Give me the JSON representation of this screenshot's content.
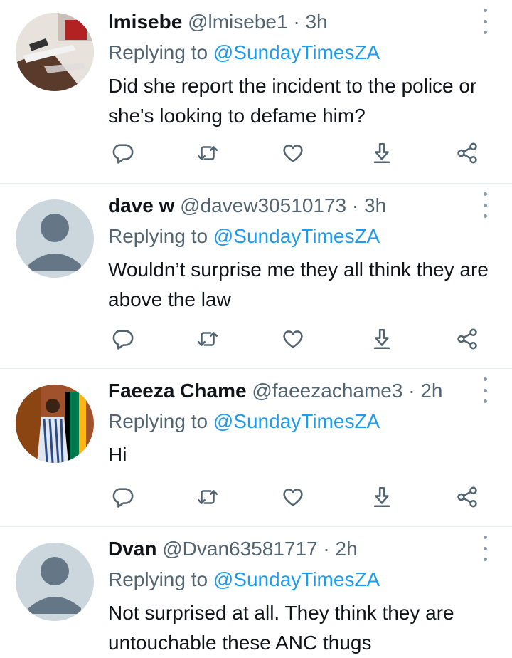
{
  "colors": {
    "mention": "#1d9bf0",
    "secondary_text": "#536471",
    "icon": "#536471",
    "divider": "#e6ecf0"
  },
  "tweets": [
    {
      "name": "lmisebe",
      "handle": "@lmisebe1",
      "sep": "·",
      "time": "3h",
      "replying_prefix": "Replying to ",
      "replying_to": "@SundayTimesZA",
      "text": "Did she report the incident to the police or she's looking to defame him?",
      "avatar": "photo-avatar"
    },
    {
      "name": "dave w",
      "handle": "@davew30510173",
      "sep": "·",
      "time": "3h",
      "replying_prefix": "Replying to ",
      "replying_to": "@SundayTimesZA",
      "text": "Wouldn’t surprise me they all think they are above the law",
      "avatar": "default-avatar"
    },
    {
      "name": "Faeeza Chame",
      "handle": "@faeezachame3",
      "sep": "·",
      "time": "2h",
      "replying_prefix": "Replying to ",
      "replying_to": "@SundayTimesZA",
      "text": "Hi",
      "avatar": "photo-avatar"
    },
    {
      "name": "Dvan",
      "handle": "@Dvan63581717",
      "sep": "·",
      "time": "2h",
      "replying_prefix": "Replying to ",
      "replying_to": "@SundayTimesZA",
      "text": "Not surprised at all. They think they are untouchable these ANC thugs",
      "avatar": "default-avatar"
    }
  ],
  "action_icons": [
    "reply-icon",
    "retweet-icon",
    "like-icon",
    "download-icon",
    "share-icon"
  ]
}
